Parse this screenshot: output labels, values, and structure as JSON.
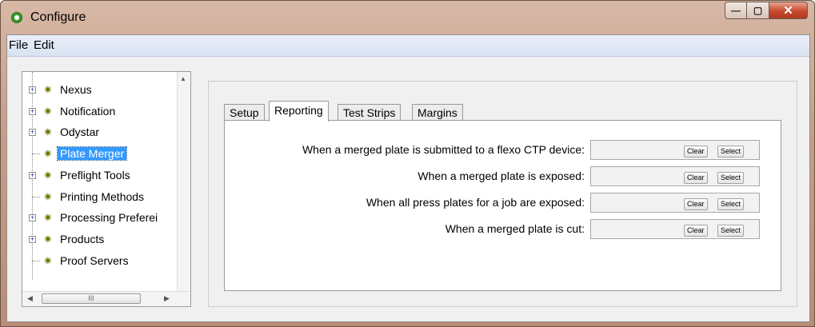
{
  "window": {
    "title": "Configure",
    "controls": {
      "minimize": "—",
      "maximize": "▢",
      "close": "✕"
    }
  },
  "menu": {
    "file": "File",
    "edit": "Edit"
  },
  "tree": {
    "items": [
      {
        "label": "Nexus",
        "expandable": true,
        "icon": "gear-icon"
      },
      {
        "label": "Notification",
        "expandable": true,
        "icon": "gear-icon"
      },
      {
        "label": "Odystar",
        "expandable": true,
        "icon": "gear-icon"
      },
      {
        "label": "Plate Merger",
        "expandable": false,
        "selected": true,
        "icon": "gear-icon"
      },
      {
        "label": "Preflight Tools",
        "expandable": true,
        "icon": "gear-icon"
      },
      {
        "label": "Printing Methods",
        "expandable": false,
        "icon": "gear-icon"
      },
      {
        "label": "Processing Preferei",
        "expandable": true,
        "icon": "gear-icon"
      },
      {
        "label": "Products",
        "expandable": true,
        "icon": "gear-icon"
      },
      {
        "label": "Proof Servers",
        "expandable": false,
        "icon": "gear-icon"
      }
    ],
    "expand_glyph": "+",
    "gear_glyph": "✷",
    "hscroll_grip": "III",
    "arrows": {
      "up": "▲",
      "left": "◀",
      "right": "▶"
    }
  },
  "tabs": [
    "Setup",
    "Reporting",
    "Test Strips",
    "Margins"
  ],
  "active_tab": "Reporting",
  "rows": [
    {
      "label": "When a merged plate is submitted to a flexo CTP device:",
      "value": "",
      "clear": "Clear",
      "select": "Select"
    },
    {
      "label": "When a merged plate is exposed:",
      "value": "",
      "clear": "Clear",
      "select": "Select"
    },
    {
      "label": "When all press plates for a job are exposed:",
      "value": "",
      "clear": "Clear",
      "select": "Select"
    },
    {
      "label": "When a merged plate is cut:",
      "value": "",
      "clear": "Clear",
      "select": "Select"
    }
  ],
  "colors": {
    "selection": "#3399ff",
    "gear": "#6e7c00",
    "titlebar": "#c79f88",
    "close_button": "#c64a2e"
  }
}
